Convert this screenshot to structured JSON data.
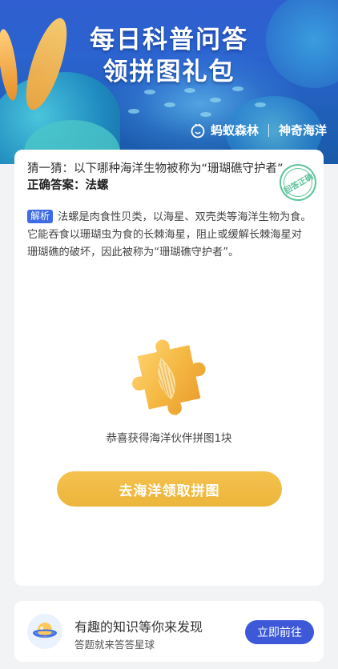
{
  "banner": {
    "title_line1": "每日科普问答",
    "title_line2": "领拼图礼包",
    "brand_left": "蚂蚁森林",
    "brand_right": "神奇海洋"
  },
  "quiz": {
    "question": "猜一猜：以下哪种海洋生物被称为“珊瑚礁守护者”",
    "answer": "正确答案：法螺",
    "stamp": "回答正确",
    "explain_tag": "解析",
    "explanation": "法螺是肉食性贝类，以海星、双壳类等海洋生物为食。它能吞食以珊瑚虫为食的长棘海星，阻止或缓解长棘海星对珊瑚礁的破坏，因此被称为“珊瑚礁守护者”。",
    "reward_text": "恭喜获得海洋伙伴拼图1块",
    "cta_label": "去海洋领取拼图"
  },
  "promo": {
    "title": "有趣的知识等你来发现",
    "subtitle": "答题就来答答星球",
    "button": "立即前往"
  },
  "colors": {
    "accent": "#3d59d8",
    "cta": "#ecb53a",
    "stamp": "#5dc49a",
    "tag": "#3d6be6"
  }
}
